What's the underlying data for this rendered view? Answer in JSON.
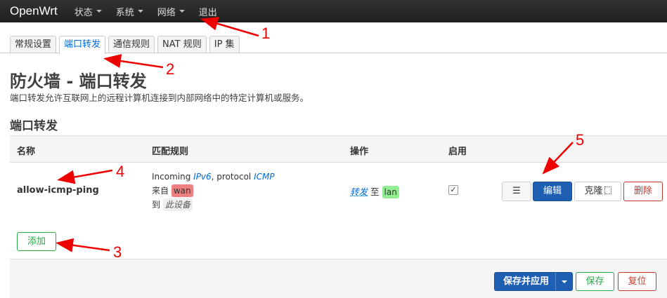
{
  "navbar": {
    "brand": "OpenWrt",
    "items": [
      {
        "label": "状态",
        "has_caret": true
      },
      {
        "label": "系统",
        "has_caret": true
      },
      {
        "label": "网络",
        "has_caret": true
      },
      {
        "label": "退出",
        "has_caret": false
      }
    ]
  },
  "tabs": [
    {
      "label": "常规设置",
      "active": false
    },
    {
      "label": "端口转发",
      "active": true
    },
    {
      "label": "通信规则",
      "active": false
    },
    {
      "label": "NAT 规则",
      "active": false
    },
    {
      "label": "IP 集",
      "active": false
    }
  ],
  "page": {
    "title": "防火墙 - 端口转发",
    "description": "端口转发允许互联网上的远程计算机连接到内部网络中的特定计算机或服务。",
    "section_title": "端口转发"
  },
  "table": {
    "headers": {
      "name": "名称",
      "match": "匹配规则",
      "action": "操作",
      "enabled": "启用"
    },
    "row": {
      "name": "allow-icmp-ping",
      "match_prefix": "Incoming ",
      "match_family": "IPv6",
      "match_mid": ", protocol ",
      "match_proto": "ICMP",
      "from_label": "来自",
      "from_zone": "wan",
      "to_label": "到",
      "to_target": "此设备",
      "action_verb": "转发",
      "action_to": "至",
      "action_zone": "lan",
      "enabled": true,
      "check_glyph": "✓",
      "btn_menu": "☰",
      "btn_edit": "编辑",
      "btn_clone": "克隆",
      "btn_delete": "删除"
    }
  },
  "buttons": {
    "add": "添加",
    "save_apply": "保存并应用",
    "save": "保存",
    "reset": "复位"
  },
  "annotations": [
    "1",
    "2",
    "3",
    "4",
    "5"
  ],
  "colors": {
    "primary": "#1e5fb4",
    "success": "#28a745",
    "danger": "#c0392b",
    "annotation": "#e00000"
  }
}
